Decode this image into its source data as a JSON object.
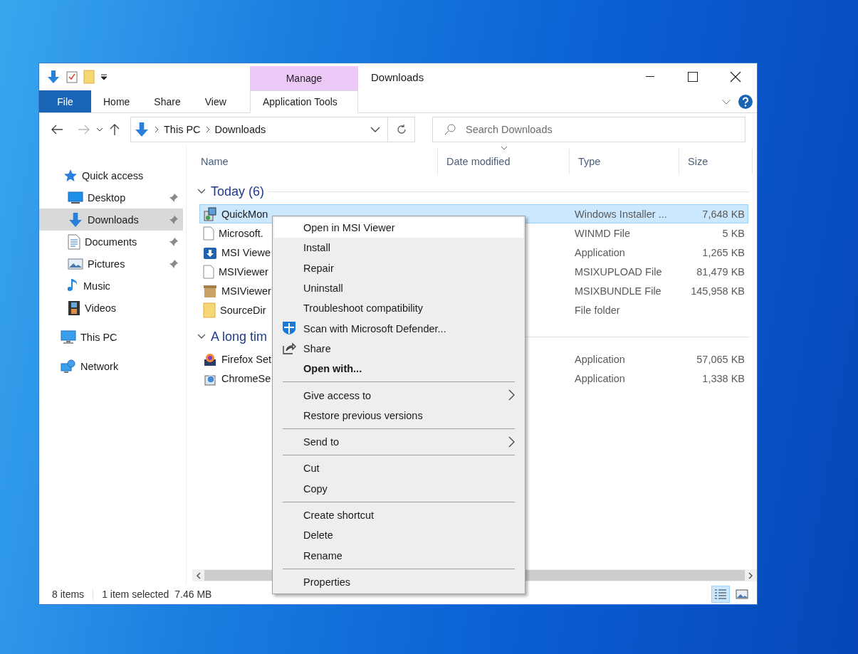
{
  "window": {
    "title": "Downloads"
  },
  "ribbon": {
    "contextual_header": "Manage",
    "tabs": [
      {
        "label": "File",
        "kind": "file",
        "selected": false
      },
      {
        "label": "Home",
        "kind": "tab",
        "selected": false
      },
      {
        "label": "Share",
        "kind": "tab",
        "selected": false
      },
      {
        "label": "View",
        "kind": "tab",
        "selected": false
      },
      {
        "label": "Application Tools",
        "kind": "contextual",
        "selected": true
      }
    ]
  },
  "address_bar": {
    "breadcrumb": [
      "This PC",
      "Downloads"
    ]
  },
  "search": {
    "placeholder": "Search Downloads"
  },
  "sidebar": {
    "items": [
      {
        "label": "Quick access",
        "selected": false,
        "children": [
          {
            "label": "Desktop",
            "selected": false,
            "pinned": true
          },
          {
            "label": "Downloads",
            "selected": true,
            "pinned": true
          },
          {
            "label": "Documents",
            "selected": false,
            "pinned": true
          },
          {
            "label": "Pictures",
            "selected": false,
            "pinned": true
          },
          {
            "label": "Music",
            "selected": false,
            "pinned": false
          },
          {
            "label": "Videos",
            "selected": false,
            "pinned": false
          }
        ]
      },
      {
        "label": "This PC",
        "selected": false
      },
      {
        "label": "Network",
        "selected": false
      }
    ]
  },
  "columns": [
    {
      "label": "Name",
      "sorted": false
    },
    {
      "label": "Date modified",
      "sorted": true
    },
    {
      "label": "Type",
      "sorted": false
    },
    {
      "label": "Size",
      "sorted": false
    }
  ],
  "groups": [
    {
      "title": "Today (6)",
      "expanded": true,
      "rows": [
        {
          "name": "QuickMon",
          "type": "Windows Installer ...",
          "size": "7,648 KB",
          "selected": true
        },
        {
          "name": "Microsoft.",
          "type": "WINMD File",
          "size": "5 KB",
          "selected": false
        },
        {
          "name": "MSI Viewe",
          "type": "Application",
          "size": "1,265 KB",
          "selected": false
        },
        {
          "name": "MSIViewer",
          "type": "MSIXUPLOAD File",
          "size": "81,479 KB",
          "selected": false
        },
        {
          "name": "MSIViewer",
          "type": "MSIXBUNDLE File",
          "size": "145,958 KB",
          "selected": false
        },
        {
          "name": "SourceDir",
          "type": "File folder",
          "selected": false
        }
      ]
    },
    {
      "title": "A long tim",
      "expanded": true,
      "rows": [
        {
          "name": "Firefox Set",
          "type": "Application",
          "size": "57,065 KB",
          "selected": false
        },
        {
          "name": "ChromeSe",
          "type": "Application",
          "size": "1,338 KB",
          "selected": false
        }
      ]
    }
  ],
  "context_menu": {
    "groups": [
      [
        {
          "label": "Open in MSI Viewer",
          "selected": true
        },
        {
          "label": "Install",
          "selected": false
        },
        {
          "label": "Repair",
          "selected": false
        },
        {
          "label": "Uninstall",
          "selected": false
        },
        {
          "label": "Troubleshoot compatibility",
          "selected": false
        },
        {
          "label": "Scan with Microsoft Defender...",
          "selected": false
        },
        {
          "label": "Share",
          "selected": false
        },
        {
          "label": "Open with...",
          "selected": false,
          "bold": true
        }
      ],
      [
        {
          "label": "Give access to",
          "selected": false,
          "submenu": true
        },
        {
          "label": "Restore previous versions",
          "selected": false
        }
      ],
      [
        {
          "label": "Send to",
          "selected": false,
          "submenu": true
        }
      ],
      [
        {
          "label": "Cut",
          "selected": false
        },
        {
          "label": "Copy",
          "selected": false
        }
      ],
      [
        {
          "label": "Create shortcut",
          "selected": false
        },
        {
          "label": "Delete",
          "selected": false
        },
        {
          "label": "Rename",
          "selected": false
        }
      ],
      [
        {
          "label": "Properties",
          "selected": false
        }
      ]
    ]
  },
  "status_bar": {
    "item_count": "8 items",
    "selection": "1 item selected",
    "selection_size": "7.46 MB"
  },
  "view_buttons": [
    {
      "kind": "details",
      "selected": true
    },
    {
      "kind": "large-icons",
      "selected": false
    }
  ]
}
